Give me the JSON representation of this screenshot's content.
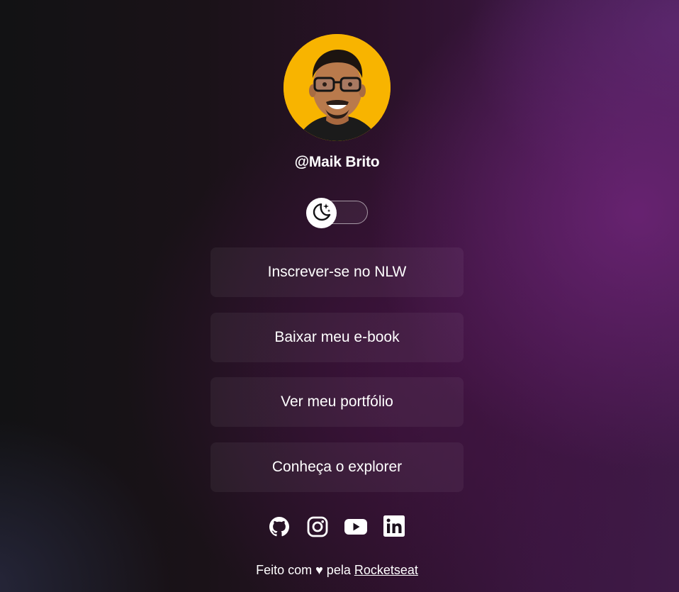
{
  "profile": {
    "username": "@Maik Brito",
    "avatar_background": "#f8b400"
  },
  "theme_switch": {
    "icon": "moon-stars-icon",
    "state": "dark"
  },
  "links": [
    {
      "label": "Inscrever-se no NLW"
    },
    {
      "label": "Baixar meu e-book"
    },
    {
      "label": "Ver meu portfólio"
    },
    {
      "label": "Conheça o explorer"
    }
  ],
  "social": [
    {
      "icon": "github-icon"
    },
    {
      "icon": "instagram-icon"
    },
    {
      "icon": "youtube-icon"
    },
    {
      "icon": "linkedin-icon"
    }
  ],
  "footer": {
    "prefix": "Feito com ♥ pela",
    "link_label": "Rocketseat"
  },
  "colors": {
    "text": "#ffffff",
    "button_bg": "rgba(255,255,255,0.05)",
    "accent_purple": "#6e2478"
  }
}
